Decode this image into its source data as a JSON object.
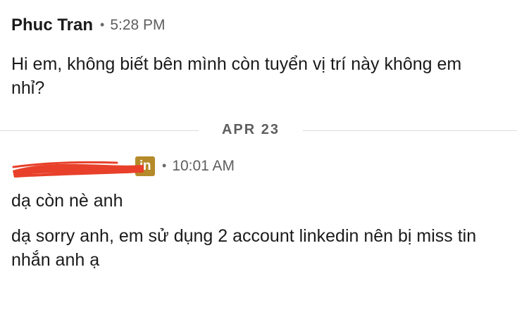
{
  "conversation": {
    "message_group_1": {
      "sender_name": "Phuc Tran",
      "separator": "•",
      "timestamp": "5:28 PM",
      "messages": [
        {
          "text": "Hi em, không biết bên mình còn tuyển vị trí này không em nhỉ?"
        }
      ]
    },
    "day_divider": {
      "label": "APR 23"
    },
    "message_group_2": {
      "sender_name_redacted": true,
      "badge_label": "in",
      "badge_icon": "linkedin-icon",
      "separator": "•",
      "timestamp": "10:01 AM",
      "messages": [
        {
          "text": "dạ còn nè anh"
        },
        {
          "text": "dạ sorry anh, em sử dụng 2 account linkedin nên bị miss tin nhắn anh ạ"
        }
      ]
    }
  },
  "colors": {
    "text_primary": "#1b1b1b",
    "text_secondary": "#5e5e5e",
    "divider": "#dcdcdc",
    "redaction": "#e8402a",
    "linkedin_badge": "#b58a2a"
  }
}
